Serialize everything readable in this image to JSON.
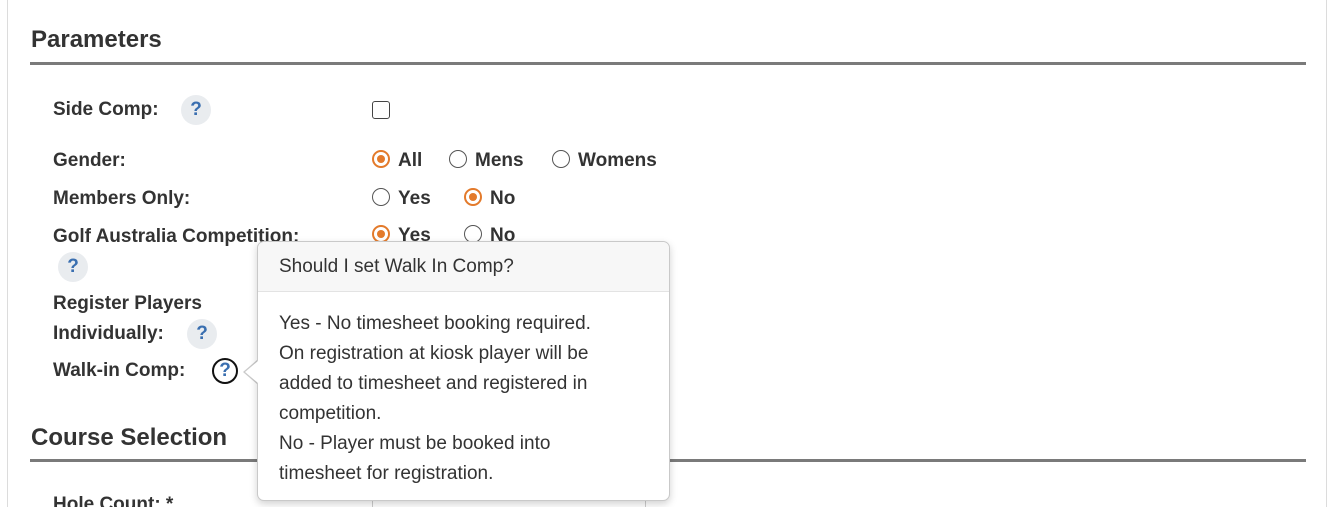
{
  "parameters": {
    "title": "Parameters",
    "side_comp": {
      "label": "Side Comp:",
      "help": "?",
      "checked": false
    },
    "gender": {
      "label": "Gender:",
      "options": [
        {
          "label": "All",
          "selected": true
        },
        {
          "label": "Mens",
          "selected": false
        },
        {
          "label": "Womens",
          "selected": false
        }
      ]
    },
    "members_only": {
      "label": "Members Only:",
      "options": [
        {
          "label": "Yes",
          "selected": false
        },
        {
          "label": "No",
          "selected": true
        }
      ]
    },
    "golf_australia": {
      "label": "Golf Australia Competition:",
      "help": "?",
      "options": [
        {
          "label": "Yes",
          "selected": true
        },
        {
          "label": "No",
          "selected": false
        }
      ]
    },
    "register_individually": {
      "label_line1": "Register Players",
      "label_line2": "Individually:",
      "help": "?"
    },
    "walk_in_comp": {
      "label": "Walk-in Comp:",
      "help": "?"
    }
  },
  "course_selection": {
    "title": "Course Selection",
    "hole_count": {
      "label": "Hole Count: *"
    }
  },
  "popover": {
    "title": "Should I set Walk In Comp?",
    "lines": [
      "Yes - No timesheet booking required.",
      "On registration at kiosk player will be",
      "added to timesheet and registered in",
      "competition.",
      "No - Player must be booked into",
      "timesheet for registration."
    ]
  },
  "colors": {
    "accent_radio": "#e37a2b",
    "help_text": "#3a6fb0",
    "rule": "#7a7a7a"
  }
}
